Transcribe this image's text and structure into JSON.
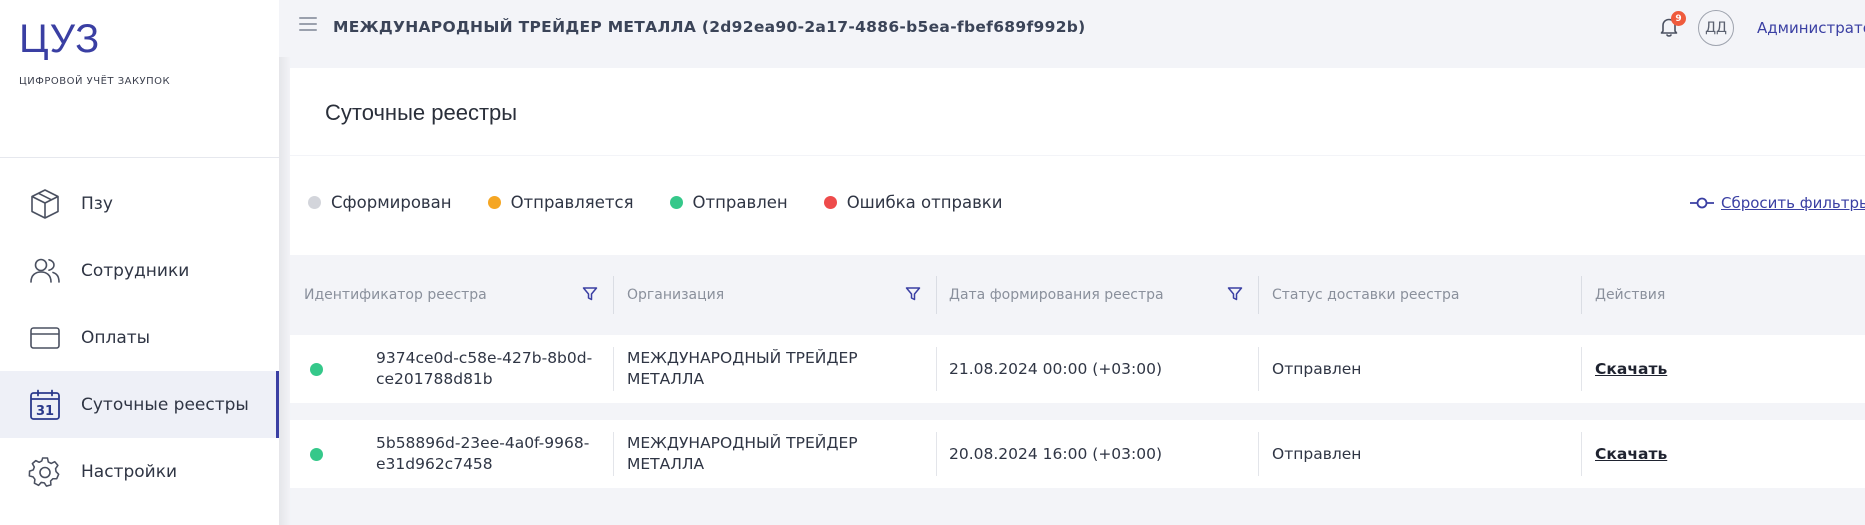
{
  "sidebar": {
    "logo": "ЦУЗ",
    "logo_subtitle": "ЦИФРОВОЙ УЧЁТ ЗАКУПОК",
    "items": [
      {
        "label": "Пзу",
        "icon": "box-icon"
      },
      {
        "label": "Сотрудники",
        "icon": "users-icon"
      },
      {
        "label": "Оплаты",
        "icon": "card-icon"
      },
      {
        "label": "Суточные реестры",
        "icon": "calendar-icon",
        "calendar_day": "31",
        "active": true
      },
      {
        "label": "Настройки",
        "icon": "gear-icon"
      }
    ]
  },
  "header": {
    "org_title": "МЕЖДУНАРОДНЫЙ ТРЕЙДЕР МЕТАЛЛА (2d92ea90-2a17-4886-b5ea-fbef689f992b)",
    "notification_count": "9",
    "avatar_initials": "ДД",
    "user_name": "Администратор"
  },
  "page": {
    "title": "Суточные реестры"
  },
  "legend": [
    {
      "label": "Сформирован",
      "color": "#d3d5db"
    },
    {
      "label": "Отправляется",
      "color": "#f5a623"
    },
    {
      "label": "Отправлен",
      "color": "#35c88a"
    },
    {
      "label": "Ошибка отправки",
      "color": "#ee4b4b"
    }
  ],
  "filters": {
    "reset_label": "Сбросить фильтры"
  },
  "table": {
    "columns": [
      {
        "label": "Идентификатор реестра",
        "filter": true
      },
      {
        "label": "Организация",
        "filter": true
      },
      {
        "label": "Дата формирования реестра",
        "filter": true
      },
      {
        "label": "Статус доставки реестра",
        "filter": false
      },
      {
        "label": "Действия",
        "filter": false
      }
    ],
    "rows": [
      {
        "id_line1": "9374ce0d-c58e-427b-8b0d-",
        "id_line2": "ce201788d81b",
        "org_line1": "МЕЖДУНАРОДНЫЙ ТРЕЙДЕР",
        "org_line2": "МЕТАЛЛА",
        "date": "21.08.2024 00:00 (+03:00)",
        "status": "Отправлен",
        "action": "Скачать",
        "status_color": "#35c88a"
      },
      {
        "id_line1": "5b58896d-23ee-4a0f-9968-",
        "id_line2": "e31d962c7458",
        "org_line1": "МЕЖДУНАРОДНЫЙ ТРЕЙДЕР",
        "org_line2": "МЕТАЛЛА",
        "date": "20.08.2024 16:00 (+03:00)",
        "status": "Отправлен",
        "action": "Скачать",
        "status_color": "#35c88a"
      }
    ]
  },
  "colors": {
    "accent": "#3a3fa3",
    "badge": "#ef5b3d",
    "background": "#f3f4f8"
  }
}
